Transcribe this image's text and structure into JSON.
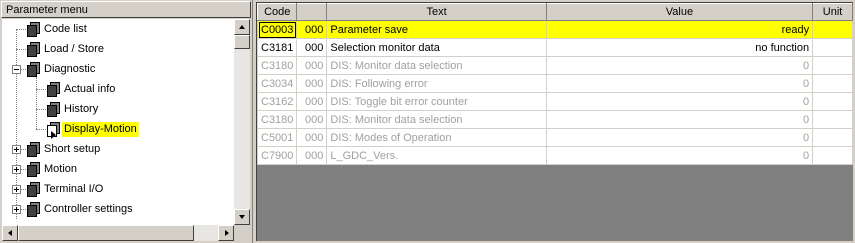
{
  "tree": {
    "header": "Parameter menu",
    "items": [
      {
        "label": "Code list",
        "icon": "book-closed-icon",
        "level": 0,
        "expander": "none"
      },
      {
        "label": "Load / Store",
        "icon": "book-closed-icon",
        "level": 0,
        "expander": "none"
      },
      {
        "label": "Diagnostic",
        "icon": "book-open-icon",
        "level": 0,
        "expander": "minus"
      },
      {
        "label": "Actual info",
        "icon": "book-closed-icon",
        "level": 1,
        "expander": "none"
      },
      {
        "label": "History",
        "icon": "book-closed-icon",
        "level": 1,
        "expander": "none"
      },
      {
        "label": "Display-Motion",
        "icon": "book-arrow-icon",
        "level": 1,
        "expander": "none",
        "selected": true
      },
      {
        "label": "Short setup",
        "icon": "book-closed-icon",
        "level": 0,
        "expander": "plus"
      },
      {
        "label": "Motion",
        "icon": "book-closed-icon",
        "level": 0,
        "expander": "plus"
      },
      {
        "label": "Terminal I/O",
        "icon": "book-closed-icon",
        "level": 0,
        "expander": "plus"
      },
      {
        "label": "Controller settings",
        "icon": "book-closed-icon",
        "level": 0,
        "expander": "plus"
      }
    ]
  },
  "table": {
    "columns": [
      "Code",
      "",
      "Text",
      "Value",
      "Unit"
    ],
    "rows": [
      {
        "code": "C0003",
        "sub": "000",
        "text": "Parameter save",
        "value": "ready",
        "unit": "",
        "state": "selected"
      },
      {
        "code": "C3181",
        "sub": "000",
        "text": "Selection monitor data",
        "value": "no function",
        "unit": "",
        "state": "active"
      },
      {
        "code": "C3180",
        "sub": "000",
        "text": "DIS: Monitor data selection",
        "value": "0",
        "unit": "",
        "state": "inactive"
      },
      {
        "code": "C3034",
        "sub": "000",
        "text": "DIS: Following error",
        "value": "0",
        "unit": "",
        "state": "inactive"
      },
      {
        "code": "C3162",
        "sub": "000",
        "text": "DIS: Toggle bit error counter",
        "value": "0",
        "unit": "",
        "state": "inactive"
      },
      {
        "code": "C3180",
        "sub": "000",
        "text": "DIS: Monitor data selection",
        "value": "0",
        "unit": "",
        "state": "inactive"
      },
      {
        "code": "C5001",
        "sub": "000",
        "text": "DIS: Modes of Operation",
        "value": "0",
        "unit": "",
        "state": "inactive"
      },
      {
        "code": "C7900",
        "sub": "000",
        "text": "L_GDC_Vers.",
        "value": "0",
        "unit": "",
        "state": "inactive"
      }
    ]
  },
  "colors": {
    "selection": "#ffff00",
    "inactive_text": "#a0a0a0",
    "panel": "#d4d0c8"
  }
}
